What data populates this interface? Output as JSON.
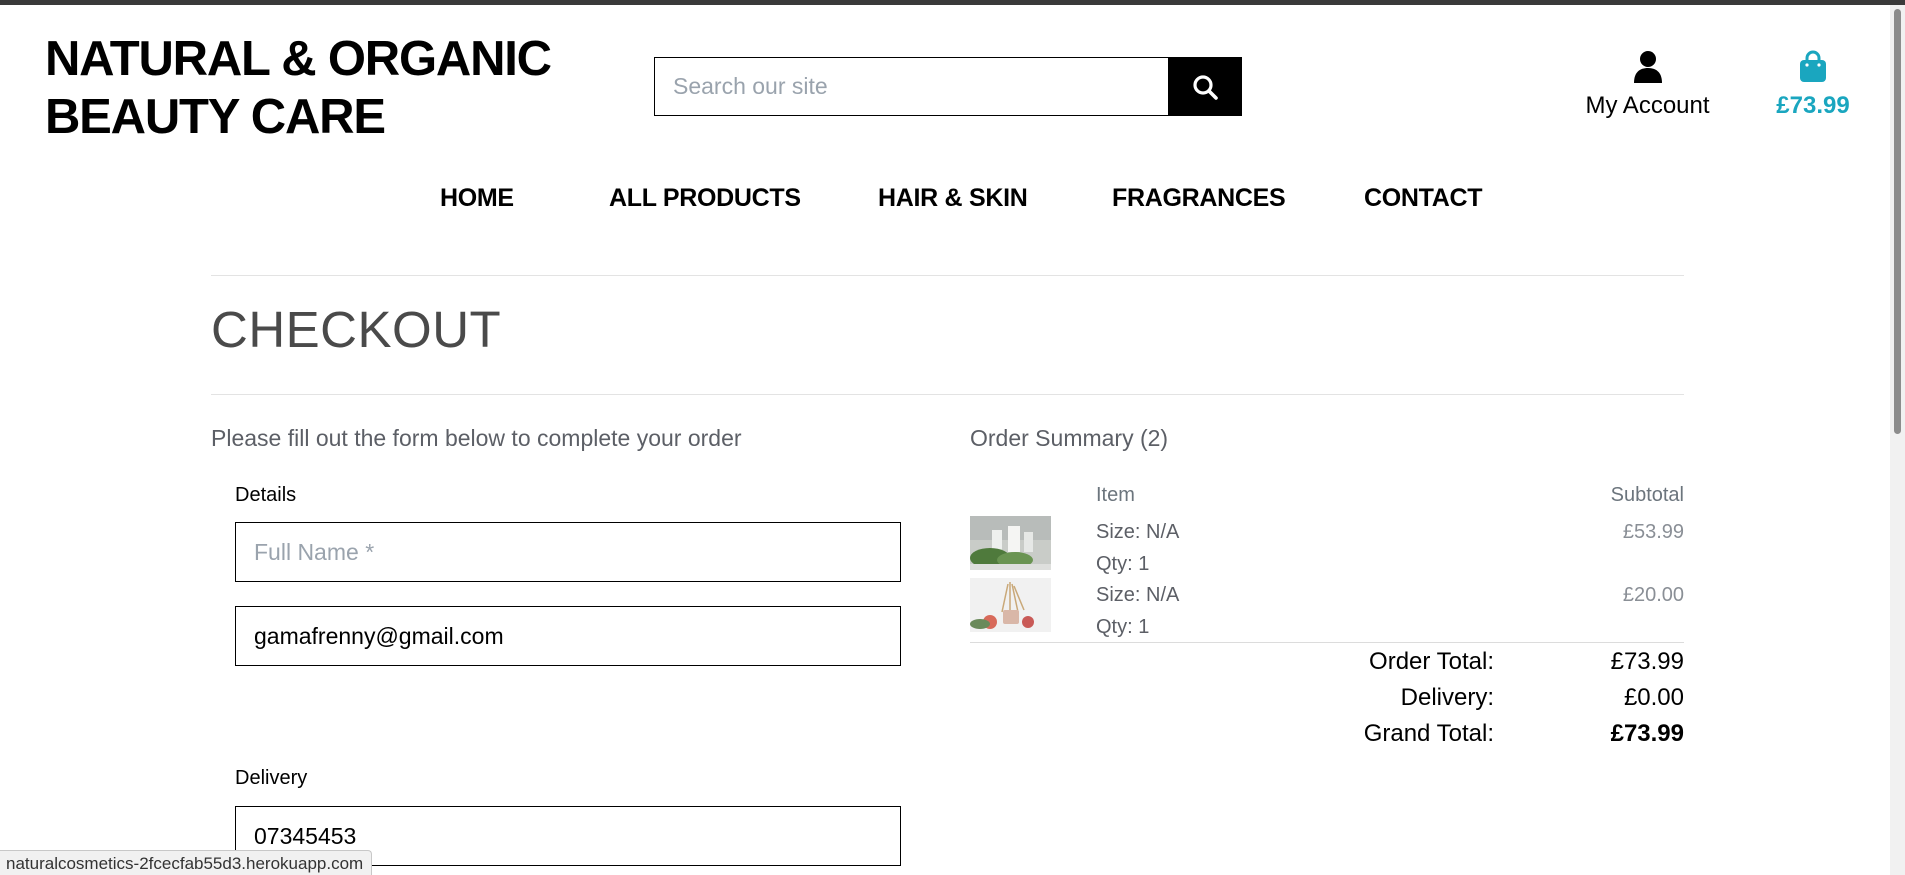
{
  "brand": {
    "line1": "NATURAL & ORGANIC",
    "line2": "BEAUTY CARE"
  },
  "search": {
    "placeholder": "Search our site",
    "icon": "search-icon"
  },
  "account": {
    "label": "My Account",
    "icon": "user-icon"
  },
  "bag": {
    "amount": "£73.99",
    "icon": "shopping-bag-icon",
    "color": "#1aa6bf"
  },
  "nav": [
    {
      "label": "HOME"
    },
    {
      "label": "ALL PRODUCTS"
    },
    {
      "label": "HAIR & SKIN"
    },
    {
      "label": "FRAGRANCES"
    },
    {
      "label": "CONTACT"
    }
  ],
  "page": {
    "title": "CHECKOUT"
  },
  "form": {
    "intro": "Please fill out the form below to complete your order",
    "details_label": "Details",
    "full_name_placeholder": "Full Name *",
    "email_value": "gamafrenny@gmail.com",
    "delivery_label": "Delivery",
    "phone_value": "07345453"
  },
  "summary": {
    "title": "Order Summary (2)",
    "col_item": "Item",
    "col_subtotal": "Subtotal",
    "items": [
      {
        "size": "Size: N/A",
        "qty": "Qty: 1",
        "subtotal": "£53.99"
      },
      {
        "size": "Size: N/A",
        "qty": "Qty: 1",
        "subtotal": "£20.00"
      }
    ],
    "order_total_label": "Order Total:",
    "order_total": "£73.99",
    "delivery_label": "Delivery:",
    "delivery": "£0.00",
    "grand_total_label": "Grand Total:",
    "grand_total": "£73.99"
  },
  "status_url": "naturalcosmetics-2fcecfab55d3.herokuapp.com"
}
